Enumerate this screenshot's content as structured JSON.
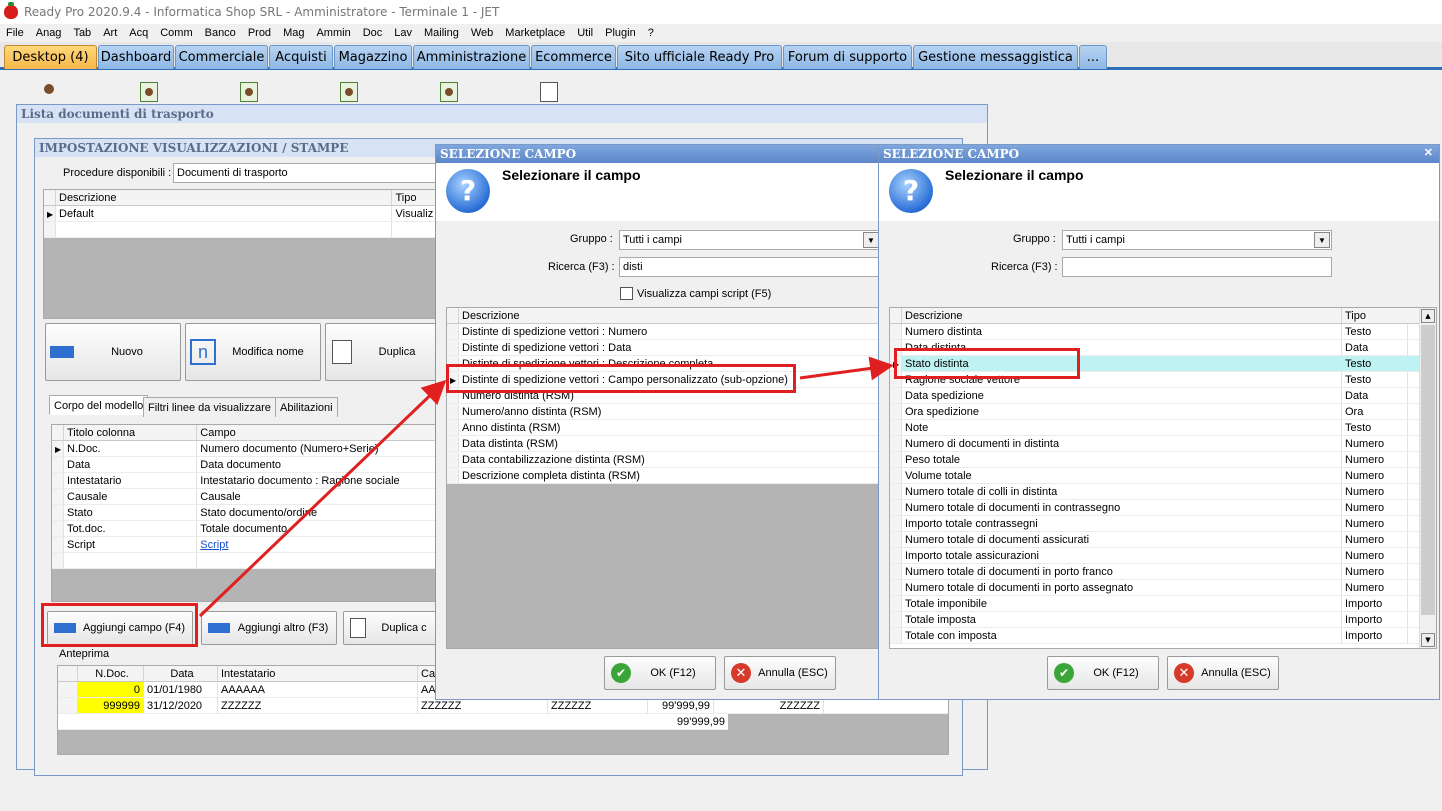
{
  "window_title": "Ready Pro 2020.9.4 - Informatica Shop SRL - Amministratore - Terminale 1 - JET",
  "menu": [
    "File",
    "Anag",
    "Tab",
    "Art",
    "Acq",
    "Comm",
    "Banco",
    "Prod",
    "Mag",
    "Ammin",
    "Doc",
    "Lav",
    "Mailing",
    "Web",
    "Marketplace",
    "Util",
    "Plugin",
    "?"
  ],
  "tabs": [
    "Desktop (4)",
    "Dashboard",
    "Commerciale",
    "Acquisti",
    "Magazzino",
    "Amministrazione",
    "Ecommerce",
    "Sito ufficiale Ready Pro",
    "Forum di supporto",
    "Gestione messaggistica",
    "..."
  ],
  "lista_title": "Lista documenti di trasporto",
  "impostazione": {
    "title": "IMPOSTAZIONE VISUALIZZAZIONI / STAMPE",
    "procedure_label": "Procedure disponibili :",
    "procedure_value": "Documenti di trasporto",
    "models_headers": [
      "Descrizione",
      "Tipo"
    ],
    "models_rows": [
      [
        "Default",
        "Visualiz"
      ]
    ],
    "btn_nuovo": "Nuovo",
    "btn_modifica": "Modifica nome",
    "btn_duplica": "Duplica",
    "subtabs": [
      "Corpo del modello",
      "Filtri linee da visualizzare",
      "Abilitazioni"
    ],
    "col_headers": [
      "Titolo colonna",
      "Campo"
    ],
    "columns": [
      [
        "N.Doc.",
        "Numero documento (Numero+Serie)"
      ],
      [
        "Data",
        "Data documento"
      ],
      [
        "Intestatario",
        "Intestatario documento : Ragione sociale"
      ],
      [
        "Causale",
        "Causale"
      ],
      [
        "Stato",
        "Stato documento/ordine"
      ],
      [
        "Tot.doc.",
        "Totale documento"
      ],
      [
        "Script",
        "Script"
      ]
    ],
    "btn_aggiungi_campo": "Aggiungi campo (F4)",
    "btn_aggiungi_altro": "Aggiungi altro (F3)",
    "btn_duplica2": "Duplica c",
    "anteprima_label": "Anteprima",
    "preview_headers": [
      "N.Doc.",
      "Data",
      "Intestatario",
      "Ca"
    ],
    "preview_rows": [
      [
        "0",
        "01/01/1980",
        "AAAAAA",
        "AA"
      ],
      [
        "999999",
        "31/12/2020",
        "ZZZZZZ",
        "ZZZZZZ"
      ]
    ],
    "preview_extra": [
      "ZZZZZZ",
      "99'999,99",
      "99'999,99",
      "ZZZZZZ"
    ]
  },
  "dialog1": {
    "title": "SELEZIONE CAMPO",
    "heading": "Selezionare il campo",
    "gruppo_label": "Gruppo :",
    "gruppo_value": "Tutti i campi",
    "ricerca_label": "Ricerca (F3) :",
    "ricerca_value": "disti",
    "checkbox_label": "Visualizza campi script (F5)",
    "header": "Descrizione",
    "rows": [
      "Distinte di spedizione vettori : Numero",
      "Distinte di spedizione vettori : Data",
      "Distinte di spedizione vettori : Descrizione completa",
      "Distinte di spedizione vettori : Campo personalizzato (sub-opzione)",
      "Numero distinta (RSM)",
      "Numero/anno distinta (RSM)",
      "Anno distinta (RSM)",
      "Data distinta (RSM)",
      "Data contabilizzazione distinta (RSM)",
      "Descrizione completa distinta (RSM)"
    ],
    "ok": "OK (F12)",
    "annulla": "Annulla (ESC)"
  },
  "dialog2": {
    "title": "SELEZIONE CAMPO",
    "close": "✕",
    "heading": "Selezionare il campo",
    "gruppo_label": "Gruppo :",
    "gruppo_value": "Tutti i campi",
    "ricerca_label": "Ricerca (F3) :",
    "ricerca_value": "",
    "headers": [
      "Descrizione",
      "Tipo"
    ],
    "rows": [
      [
        "Numero distinta",
        "Testo"
      ],
      [
        "Data distinta",
        "Data"
      ],
      [
        "Stato distinta",
        "Testo"
      ],
      [
        "Ragione sociale vettore",
        "Testo"
      ],
      [
        "Data spedizione",
        "Data"
      ],
      [
        "Ora spedizione",
        "Ora"
      ],
      [
        "Note",
        "Testo"
      ],
      [
        "Numero di documenti in distinta",
        "Numero"
      ],
      [
        "Peso totale",
        "Numero"
      ],
      [
        "Volume totale",
        "Numero"
      ],
      [
        "Numero totale di colli in distinta",
        "Numero"
      ],
      [
        "Numero totale di documenti in contrassegno",
        "Numero"
      ],
      [
        "Importo totale contrassegni",
        "Numero"
      ],
      [
        "Numero totale di documenti assicurati",
        "Numero"
      ],
      [
        "Importo totale assicurazioni",
        "Numero"
      ],
      [
        "Numero totale di documenti in porto franco",
        "Numero"
      ],
      [
        "Numero totale di documenti in porto assegnato",
        "Numero"
      ],
      [
        "Totale imponibile",
        "Importo"
      ],
      [
        "Totale imposta",
        "Importo"
      ],
      [
        "Totale con imposta",
        "Importo"
      ]
    ],
    "ok": "OK (F12)",
    "annulla": "Annulla (ESC)"
  },
  "colors": {
    "accent": "#2d6fb7",
    "highlight": "#bff3f3",
    "annotation": "#e02020",
    "preview_yellow": "#ffff00"
  }
}
